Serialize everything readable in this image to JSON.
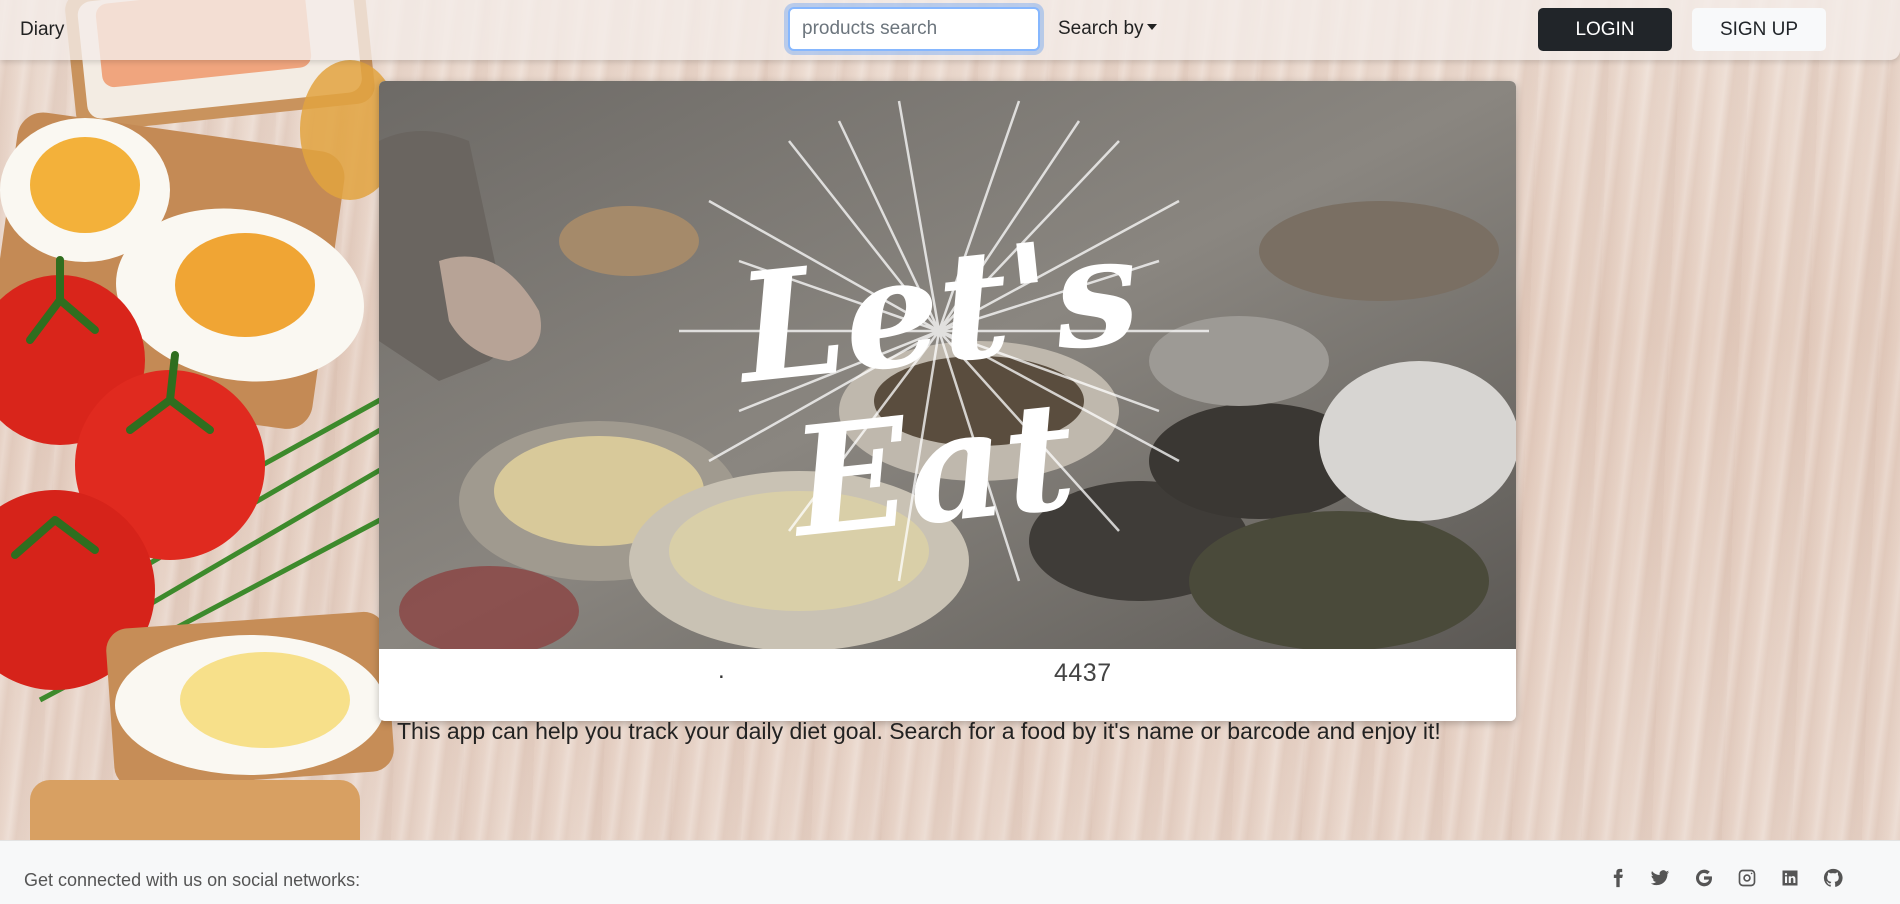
{
  "nav": {
    "brand": "Diary",
    "search_placeholder": "products search",
    "search_by": "Search by",
    "login": "LOGIN",
    "signup": "SIGN UP"
  },
  "hero": {
    "image_title_line1": "Let's",
    "image_title_line2": "Eat",
    "caption_dot": ".",
    "caption_number": "4437"
  },
  "intro_text": "This app can help you track your daily diet goal. Search for a food by it's name or barcode and enjoy it!",
  "footer": {
    "connect_text": "Get connected with us on social networks:",
    "social_icons": [
      "facebook-icon",
      "twitter-icon",
      "google-icon",
      "instagram-icon",
      "linkedin-icon",
      "github-icon"
    ]
  },
  "colors": {
    "login_bg": "#212529",
    "signup_bg": "#f8f9fa",
    "focus_ring": "#86b7fe",
    "footer_bg": "#f7f8f9"
  }
}
